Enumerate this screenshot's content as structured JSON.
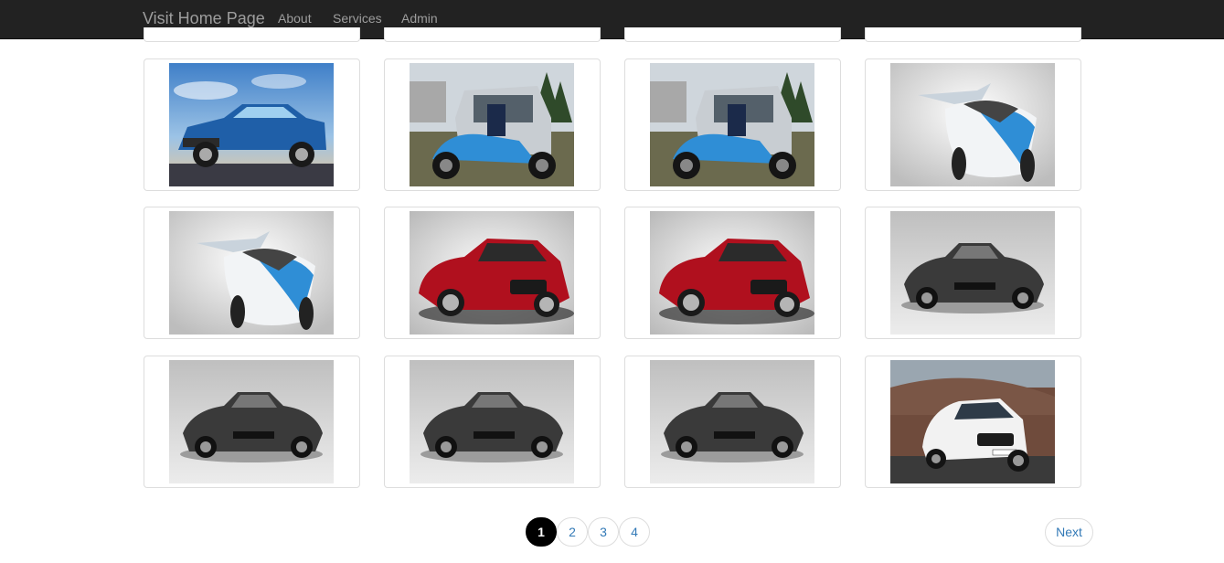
{
  "navbar": {
    "brand": "Visit Home Page",
    "links": [
      "About",
      "Services",
      "Admin"
    ]
  },
  "gallery": {
    "rows": [
      [
        "blue-muscle-car",
        "blue-trike-smart",
        "blue-trike-smart",
        "white-blue-flying-car"
      ],
      [
        "white-blue-flying-car",
        "red-jaguar",
        "red-jaguar",
        "dark-supercar"
      ],
      [
        "dark-supercar",
        "dark-supercar",
        "dark-supercar",
        "white-ford-fiesta"
      ]
    ]
  },
  "pagination": {
    "pages": [
      "1",
      "2",
      "3",
      "4"
    ],
    "active_page": "1",
    "next_label": "Next"
  },
  "colors": {
    "navbar_bg": "#222222",
    "nav_text": "#9d9d9d",
    "link": "#337ab7",
    "active_page_bg": "#000000"
  }
}
